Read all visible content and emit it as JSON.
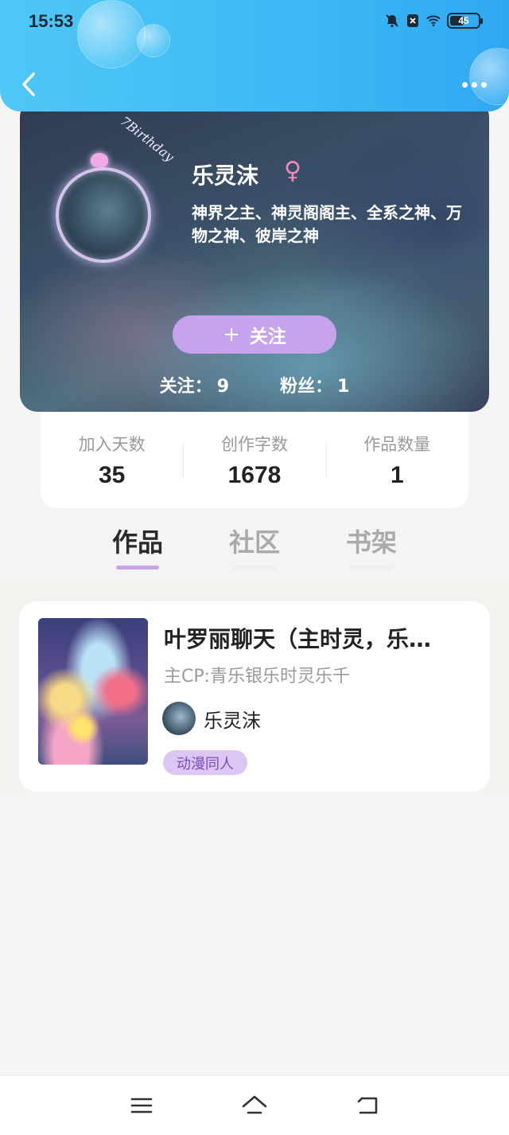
{
  "status_bar": {
    "time": "15:53",
    "battery": "45",
    "icons": [
      "bell-muted-icon",
      "notification-box-icon",
      "wifi-icon",
      "battery-icon"
    ]
  },
  "header": {
    "back_icon": "chevron-left-icon",
    "more_icon": "more-dots-icon",
    "accent_color": "#3dbaf5"
  },
  "profile": {
    "username": "乐灵沫",
    "gender_symbol": "♀",
    "avatar_decoration": "7Birthday",
    "titles": "神界之主、神灵阁阁主、全系之神、万物之神、彼岸之神",
    "follow_button": {
      "plus": "+",
      "label": "关注"
    },
    "following_label": "关注：",
    "following_value": "9",
    "fans_label": "粉丝：",
    "fans_value": "1"
  },
  "stats": [
    {
      "label": "加入天数",
      "value": "35"
    },
    {
      "label": "创作字数",
      "value": "1678"
    },
    {
      "label": "作品数量",
      "value": "1"
    }
  ],
  "tabs": [
    {
      "label": "作品",
      "active": true
    },
    {
      "label": "社区",
      "active": false
    },
    {
      "label": "书架",
      "active": false
    }
  ],
  "works": [
    {
      "title": "叶罗丽聊天（主时灵，乐…",
      "cp": "主CP:青乐银乐时灵乐千",
      "author": "乐灵沫",
      "tag": "动漫同人"
    }
  ],
  "nav": [
    "menu-icon",
    "home-icon",
    "back-icon"
  ],
  "colors": {
    "accent_purple": "#c6a3ec",
    "tag_bg": "#dcc6f3",
    "tag_text": "#7b4cb5",
    "female_pink": "#f08cb6"
  }
}
